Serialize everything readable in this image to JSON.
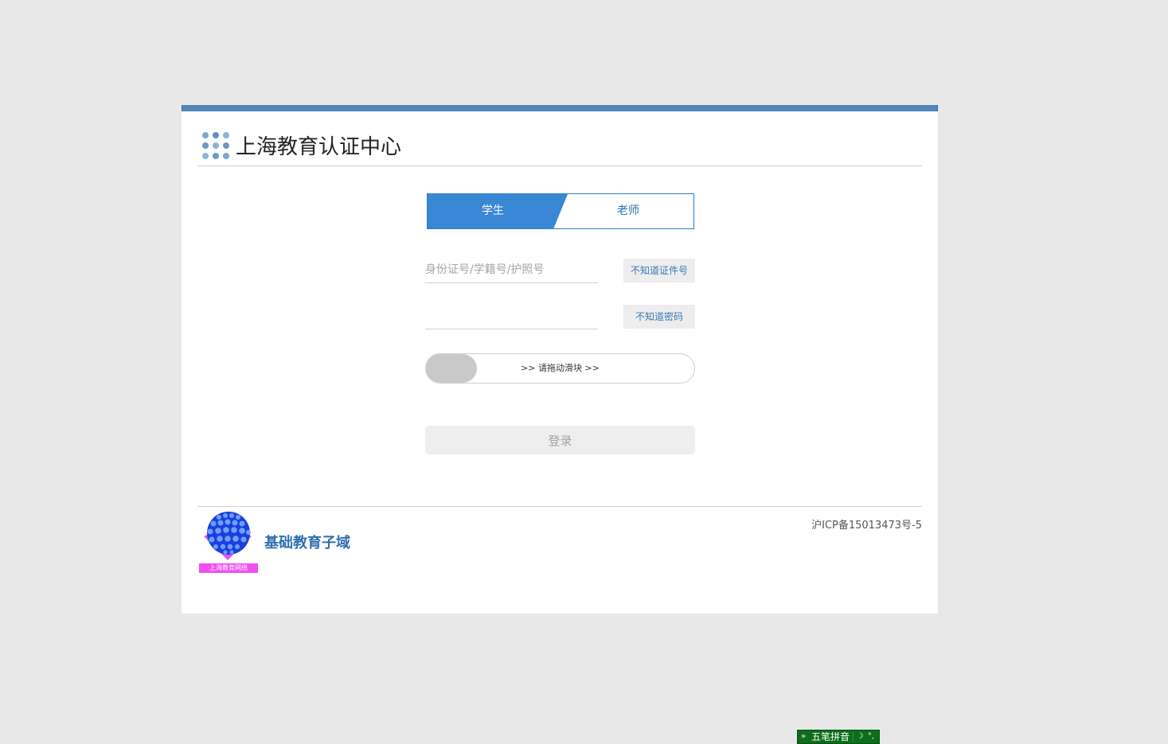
{
  "header": {
    "title": "上海教育认证中心",
    "logo_icon": "dot-grid-icon"
  },
  "tabs": {
    "student_label": "学生",
    "teacher_label": "老师",
    "active": "student"
  },
  "form": {
    "id_placeholder": "身份证号/学籍号/护照号",
    "id_value": "",
    "password_placeholder": "",
    "password_value": "",
    "forgot_id_label": "不知道证件号",
    "forgot_password_label": "不知道密码",
    "slider_hint": ">> 请拖动滑块 >>",
    "login_label": "登录"
  },
  "footer": {
    "logo_caption": "上海教育网络",
    "subdomain_title": "基础教育子域",
    "icp": "沪ICP备15013473号-5"
  },
  "ime": {
    "toggle_glyph": "»",
    "mode_label": "五笔拼音",
    "moon_glyph": "☽",
    "punct_glyph": "°,"
  },
  "colors": {
    "accent": "#3a87d6",
    "top_bar": "#5286b8",
    "link": "#2f6fb3",
    "ime_bg": "#0c6d1b",
    "page_bg": "#e8e8e8"
  }
}
